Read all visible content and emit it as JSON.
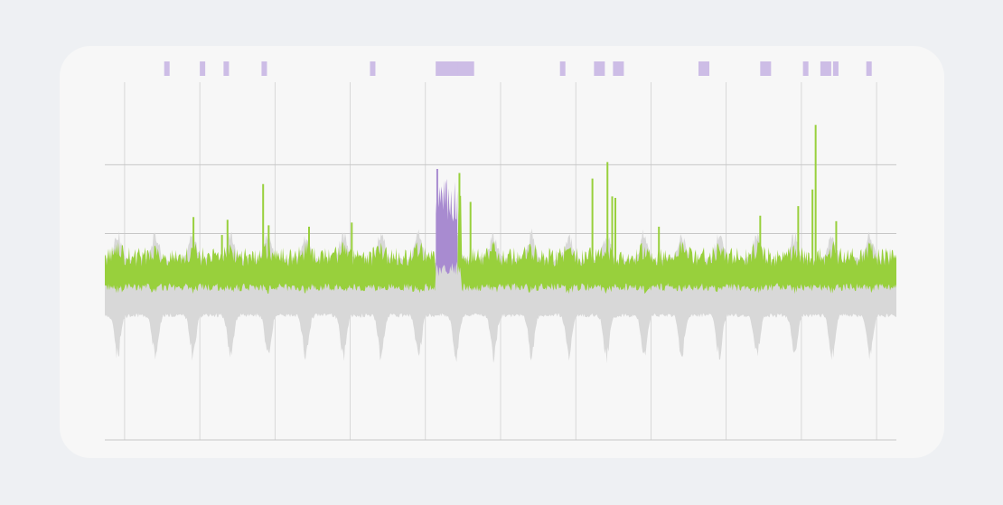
{
  "chart_data": {
    "type": "area",
    "title": "",
    "xlabel": "",
    "ylabel": "",
    "grid": true,
    "x_range": [
      0,
      1000
    ],
    "y_range": [
      -1,
      1.6
    ],
    "y_gridlines": [
      -1,
      0,
      0.5,
      1.0
    ],
    "x_gridlines": [
      25,
      120,
      215,
      310,
      405,
      500,
      595,
      690,
      785,
      880,
      975
    ],
    "colors": {
      "observed": "#98d03c",
      "anomaly": "#a88bd0",
      "anomaly_marker": "#cdbde6",
      "envelope": "#d8d8d8",
      "grid": "#c7c7c7"
    },
    "series": [
      {
        "role": "envelope",
        "description_values": {
          "upper_typical": 0.28,
          "lower_typical": -0.08,
          "lower_dip": -0.42,
          "dip_period": 47.5
        }
      },
      {
        "role": "observed",
        "baseline_band": [
          0.08,
          0.32
        ],
        "spikes": [
          {
            "x": 200,
            "y": 0.86
          },
          {
            "x": 155,
            "y": 0.6
          },
          {
            "x": 112,
            "y": 0.62
          },
          {
            "x": 148,
            "y": 0.49
          },
          {
            "x": 207,
            "y": 0.56
          },
          {
            "x": 258,
            "y": 0.55
          },
          {
            "x": 312,
            "y": 0.58
          },
          {
            "x": 448,
            "y": 0.94
          },
          {
            "x": 462,
            "y": 0.73
          },
          {
            "x": 616,
            "y": 0.9
          },
          {
            "x": 635,
            "y": 1.02
          },
          {
            "x": 641,
            "y": 0.77
          },
          {
            "x": 645,
            "y": 0.76
          },
          {
            "x": 700,
            "y": 0.55
          },
          {
            "x": 828,
            "y": 0.63
          },
          {
            "x": 876,
            "y": 0.7
          },
          {
            "x": 894,
            "y": 0.82
          },
          {
            "x": 898,
            "y": 1.29
          },
          {
            "x": 924,
            "y": 0.59
          }
        ]
      },
      {
        "role": "anomaly",
        "x_range": [
          418,
          446
        ],
        "peak": 0.97
      }
    ],
    "anomaly_markers": [
      {
        "x": 75,
        "w": 6
      },
      {
        "x": 120,
        "w": 6
      },
      {
        "x": 150,
        "w": 6
      },
      {
        "x": 198,
        "w": 6
      },
      {
        "x": 335,
        "w": 6
      },
      {
        "x": 418,
        "w": 30
      },
      {
        "x": 446,
        "w": 18
      },
      {
        "x": 575,
        "w": 6
      },
      {
        "x": 618,
        "w": 12
      },
      {
        "x": 642,
        "w": 12
      },
      {
        "x": 750,
        "w": 12
      },
      {
        "x": 828,
        "w": 12
      },
      {
        "x": 882,
        "w": 6
      },
      {
        "x": 904,
        "w": 12
      },
      {
        "x": 920,
        "w": 6
      },
      {
        "x": 962,
        "w": 6
      }
    ]
  }
}
